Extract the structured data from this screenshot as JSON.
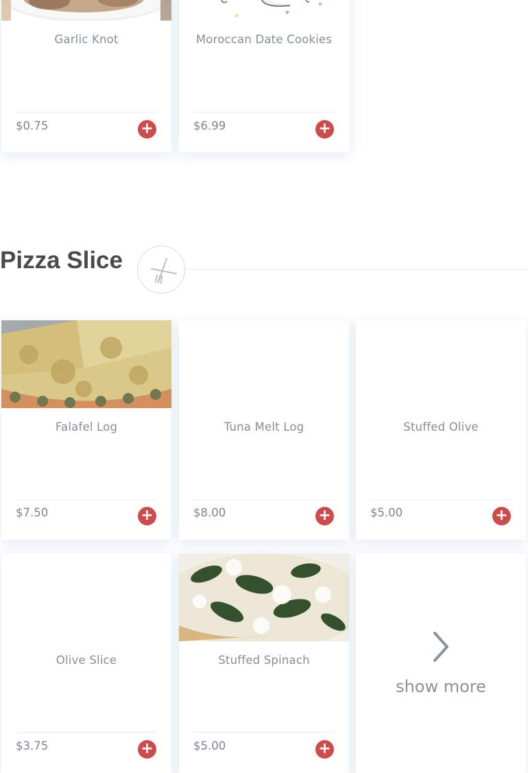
{
  "top_row": [
    {
      "name": "Garlic Knot",
      "price": "$0.75",
      "image": "garlic-knot-photo"
    },
    {
      "name": "Moroccan Date Cookies",
      "price": "$6.99",
      "image": "cookies-photo"
    }
  ],
  "section": {
    "title": "Pizza Slice",
    "icon": "fork-knife-icon"
  },
  "grid": [
    {
      "name": "Falafel Log",
      "price": "$7.50",
      "image": "pizza-photo"
    },
    {
      "name": "Tuna Melt Log",
      "price": "$8.00",
      "image": ""
    },
    {
      "name": "Stuffed Olive",
      "price": "$5.00",
      "image": ""
    },
    {
      "name": "Olive Slice",
      "price": "$3.75",
      "image": ""
    },
    {
      "name": "Stuffed Spinach",
      "price": "$5.00",
      "image": "spinach-pizza-photo"
    }
  ],
  "show_more": {
    "label": "show more",
    "icon": "chevron-right-icon"
  },
  "colors": {
    "add_button": "#cf4a4a",
    "text_muted": "#858e99",
    "title": "#4a4a4a"
  }
}
